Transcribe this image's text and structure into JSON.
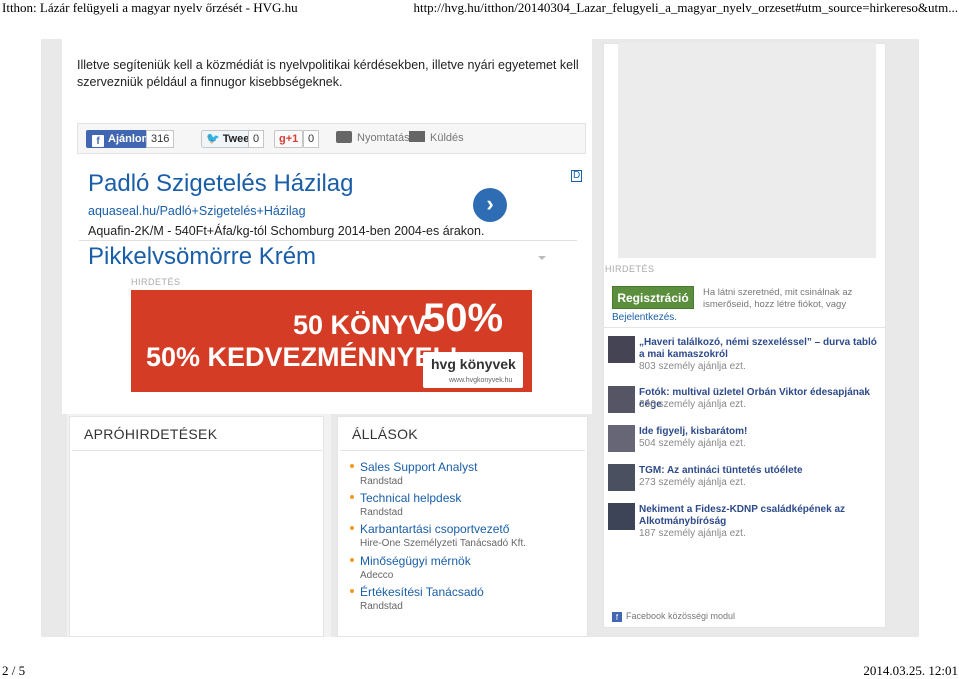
{
  "print_header": {
    "title": "Itthon: Lázár felügyeli a magyar nyelv őrzését - HVG.hu",
    "url": "http://hvg.hu/itthon/20140304_Lazar_felugyeli_a_magyar_nyelv_orzeset#utm_source=hirkereso&utm..."
  },
  "article": {
    "intro": "Illetve segíteniük kell a közmédiát is nyelvpolitikai kérdésekben, illetve nyári egyetemet kell szervezniük például a finnugor kisebbségeknek."
  },
  "share_bar": {
    "fb_like_label": "Ajánlom",
    "fb_like_count": "316",
    "tweet_label": "Tweet",
    "tweet_count": "0",
    "gplus_label": "+1",
    "gplus_count": "0",
    "print_label": "Nyomtatás",
    "send_label": "Küldés"
  },
  "text_ad": {
    "title": "Padló Szigetelés Házilag",
    "url": "aquaseal.hu/Padló+Szigetelés+Házilag",
    "description": "Aquafin-2K/M - 540Ft+Áfa/kg-tól Schomburg 2014-ben 2004-es árakon.",
    "next_title": "Pikkelysömörre Krém",
    "badge": "D"
  },
  "banner": {
    "label": "HIRDETÉS",
    "line1": "50 KÖNYV",
    "line2": "50% KEDVEZMÉNNYEL!",
    "percent": "50%",
    "logo": "hvg könyvek",
    "logo_url": "www.hvgkonyvek.hu"
  },
  "classifieds": {
    "title": "APRÓHIRDETÉSEK"
  },
  "jobs": {
    "title": "ÁLLÁSOK",
    "items": [
      {
        "title": "Sales Support Analyst",
        "company": "Randstad"
      },
      {
        "title": "Technical helpdesk",
        "company": "Randstad"
      },
      {
        "title": "Karbantartási csoportvezető",
        "company": "Hire-One Személyzeti Tanácsadó Kft."
      },
      {
        "title": "Minőségügyi mérnök",
        "company": "Adecco"
      },
      {
        "title": "Értékesítési Tanácsadó",
        "company": "Randstad"
      }
    ]
  },
  "sidebar": {
    "ad_label": "HIRDETÉS",
    "register_button": "Regisztráció",
    "register_text": "Ha látni szeretnéd, mit csinálnak az ismerőseid, hozz létre fiókot, vagy",
    "login_link": "Bejelentkezés.",
    "items": [
      {
        "title": "„Haveri találkozó, némi szexeléssel” – durva tabló a mai kamaszokról",
        "meta": "803 személy ajánlja ezt."
      },
      {
        "title": "Fotók: multival üzletel Orbán Viktor édesapjának cége",
        "meta": "336 személy ajánlja ezt."
      },
      {
        "title": "Ide figyelj, kisbarátom!",
        "meta": "504 személy ajánlja ezt."
      },
      {
        "title": "TGM: Az antináci tüntetés utóélete",
        "meta": "273 személy ajánlja ezt."
      },
      {
        "title": "Nekiment a Fidesz-KDNP családképének az Alkotmánybíróság",
        "meta": "187 személy ajánlja ezt."
      }
    ],
    "module_label": "Facebook közösségi modul"
  },
  "print_footer": {
    "page": "2 / 5",
    "datetime": "2014.03.25. 12:01"
  }
}
